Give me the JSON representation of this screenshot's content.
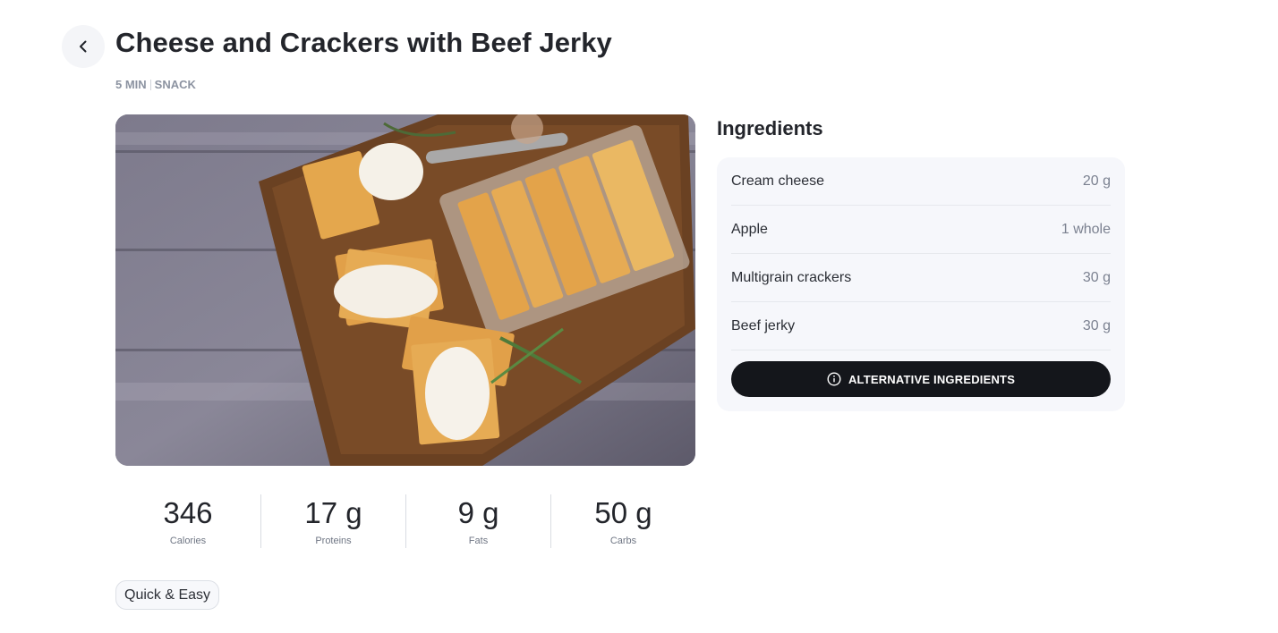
{
  "recipe": {
    "title": "Cheese and Crackers with Beef Jerky",
    "time": "5 MIN",
    "category": "SNACK",
    "image_alt": "Crackers with cream cheese, rosemary and a tray of crackers on a wooden board"
  },
  "back_button": {
    "icon": "chevron-left-icon"
  },
  "nutrition": [
    {
      "value": "346",
      "label": "Calories"
    },
    {
      "value": "17 g",
      "label": "Proteins"
    },
    {
      "value": "9 g",
      "label": "Fats"
    },
    {
      "value": "50 g",
      "label": "Carbs"
    }
  ],
  "tags": [
    "Quick & Easy"
  ],
  "ingredients": {
    "heading": "Ingredients",
    "items": [
      {
        "name": "Cream cheese",
        "qty": "20 g"
      },
      {
        "name": "Apple",
        "qty": "1 whole"
      },
      {
        "name": "Multigrain crackers",
        "qty": "30 g"
      },
      {
        "name": "Beef jerky",
        "qty": "30 g"
      }
    ],
    "alt_button_label": "ALTERNATIVE INGREDIENTS",
    "alt_button_icon": "info-icon"
  },
  "colors": {
    "button_dark": "#14161b",
    "card_bg": "#f6f7fb",
    "muted_text": "#8c93a1"
  }
}
